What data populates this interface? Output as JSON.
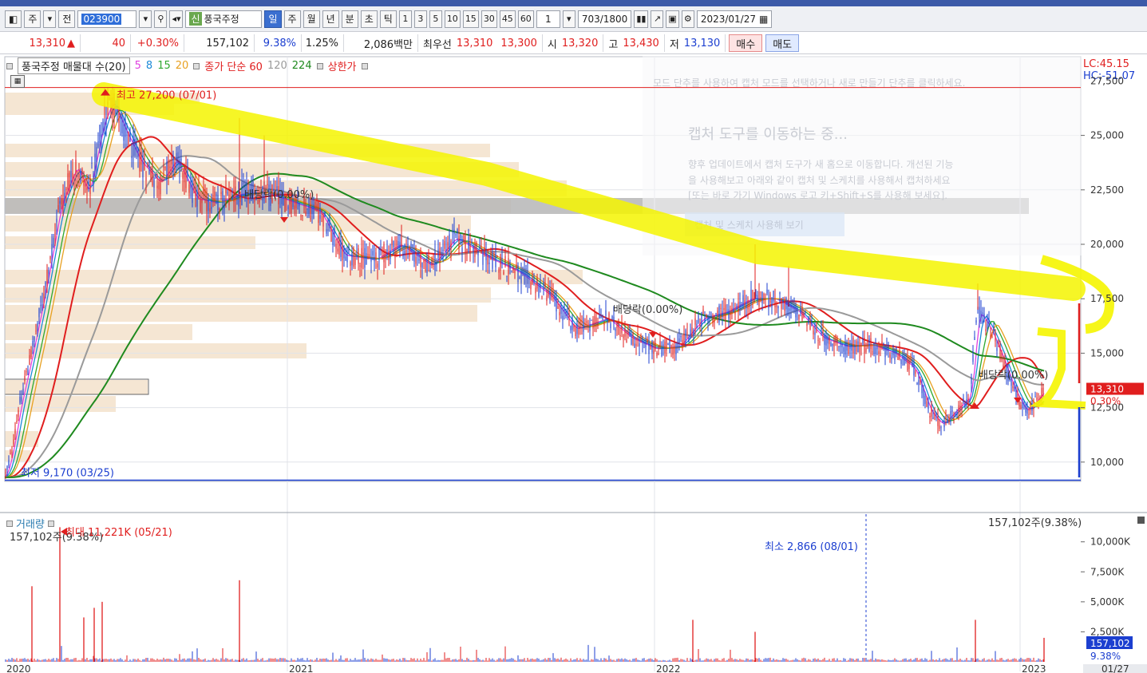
{
  "toolbar": {
    "items_left": [
      "주",
      "전"
    ],
    "code": "023900",
    "stock_badge": "신",
    "stock_name": "풍국주정",
    "periods": [
      "일",
      "주",
      "월",
      "년",
      "분",
      "초",
      "틱"
    ],
    "active_period": "일",
    "nums": [
      "1",
      "3",
      "5",
      "10",
      "15",
      "30",
      "45",
      "60"
    ],
    "unit": "1",
    "count": "703",
    "total": "/1800",
    "date": "2023/01/27"
  },
  "quote": {
    "price": "13,310",
    "arrow": "▲",
    "change": "40",
    "change_pct": "+0.30%",
    "volume": "157,102",
    "turnover": "9.38%",
    "ratio": "1.25%",
    "amount": "2,086백만",
    "best_label": "최우선",
    "best_ask": "13,310",
    "best_bid": "13,300",
    "open_label": "시",
    "open": "13,320",
    "high_label": "고",
    "high": "13,430",
    "low_label": "저",
    "low": "13,130",
    "buy_label": "매수",
    "sell_label": "매도"
  },
  "legend": {
    "title": "풍국주정 매물대 수(20)",
    "ma_values": [
      "5",
      "8",
      "15",
      "20"
    ],
    "ma_colors": [
      "#e040e0",
      "#1c8ad8",
      "#2ea82e",
      "#e8a020"
    ],
    "label_close": "종가 단순 60",
    "v120": "120",
    "v224": "224",
    "label_limit": "상한가"
  },
  "volume_legend": {
    "title": "거래량"
  },
  "chart_data": [
    {
      "type": "line",
      "title": "풍국주정",
      "subtitle": "매물대 수(20)",
      "x": [
        "2020",
        "2021",
        "2022",
        "2023"
      ],
      "x_ticks_extra": [
        "01/27"
      ],
      "ylim": [
        9000,
        27500
      ],
      "y_ticks": [
        10000,
        12500,
        15000,
        17500,
        20000,
        22500,
        25000
      ],
      "y_tick_labels": [
        "10,000",
        "12,500",
        "15,000",
        "17,500",
        "20,000",
        "22,500",
        "25,000"
      ],
      "y_tick_label_top": "27,500",
      "grid": true,
      "series": [
        {
          "name": "5",
          "color": "#e040e0"
        },
        {
          "name": "8",
          "color": "#1c8ad8"
        },
        {
          "name": "15",
          "color": "#2ea82e"
        },
        {
          "name": "20",
          "color": "#e8a020"
        },
        {
          "name": "60",
          "color": "#e01e1e"
        },
        {
          "name": "120",
          "color": "#9a9a9a"
        },
        {
          "name": "224",
          "color": "#1f8a1f"
        }
      ],
      "annotations": {
        "high": "최고 27,200 (07/01)",
        "high_value": 27200,
        "low": "최저 9,170 (03/25)",
        "low_value": 9170,
        "dividend": [
          "배당락(0.00%)",
          "배당락(0.00%)",
          "배당락(0.00%)"
        ],
        "lc": "LC:45.15",
        "hc": "HC:-51.07",
        "last_price": "13,310",
        "last_pct": "0.30%",
        "last_value": 13310
      }
    },
    {
      "type": "bar",
      "title": "거래량",
      "ylim": [
        0,
        12000
      ],
      "y_ticks": [
        2500,
        5000,
        7500,
        10000
      ],
      "y_tick_labels": [
        "2,500K",
        "5,000K",
        "7,500K",
        "10,000K"
      ],
      "annotations": {
        "max": "최대 11,221K (05/21)",
        "max_value": 11221,
        "min": "최소 2,866 (08/01)",
        "current_left": "157,102주(9.38%)",
        "current_right": "157,102주(9.38%)",
        "last_value": "157,102",
        "last_pct": "9.38%"
      }
    }
  ],
  "overlay": {
    "popup_title": "캡처 도구를 이동하는 중...",
    "popup_text1": "향후 업데이트에서 캡처 도구가 새 홈으로 이동합니다. 개선된 기능",
    "popup_text2": "을 사용해보고 아래와 같이 캡처 및 스케치를 사용해서 캡처하세요",
    "popup_text3": "[또는 바로 가기 Windows 로고 키+Shift+S를 사용해 보세요].",
    "popup_button": "캡처 및 스케치 사용해 보기",
    "faint_top": "모드 단추를 사용하여 캡처 모드를 선택하거나 새로 만들기 단추를 클릭하세요."
  }
}
